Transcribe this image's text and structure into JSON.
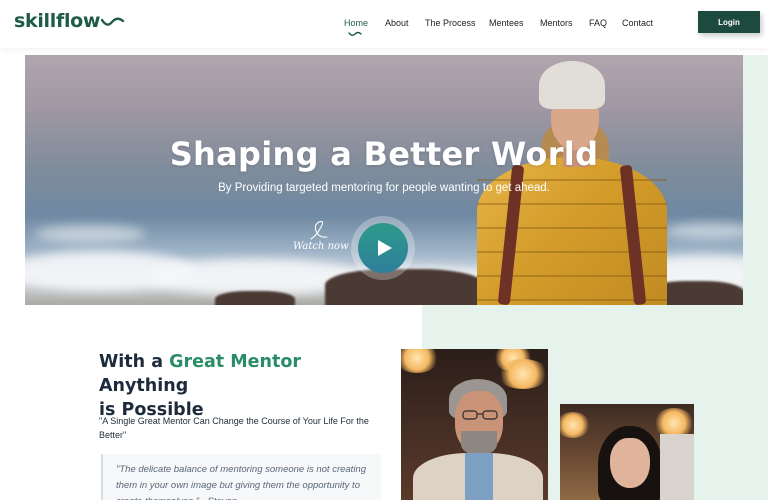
{
  "brand": {
    "logo_text": "skillflow",
    "accent_color": "#1f5c45",
    "button_color": "#1d4a3f",
    "mint_color": "#e5f3ec"
  },
  "nav": {
    "items": [
      {
        "label": "Home",
        "active": true
      },
      {
        "label": "About",
        "active": false
      },
      {
        "label": "The Process",
        "active": false
      },
      {
        "label": "Mentees",
        "active": false
      },
      {
        "label": "Mentors",
        "active": false
      },
      {
        "label": "FAQ",
        "active": false
      },
      {
        "label": "Contact",
        "active": false
      }
    ],
    "login_label": "Login"
  },
  "hero": {
    "title": "Shaping a Better World",
    "subtitle": "By Providing targeted mentoring for people wanting to get ahead.",
    "watch_label": "Watch now",
    "play_icon": "play-icon"
  },
  "intro": {
    "heading_prefix": "With a",
    "heading_accent": "Great Mentor",
    "heading_mid": "Anything",
    "heading_suffix": "is Possible",
    "quote_line": "\"A Single Great Mentor Can Change the Course of Your Life For the Better\"",
    "blockquote": "\"The delicate balance of mentoring someone is not creating them in your own image but giving them the opportunity to create themselves.\" - Steven"
  }
}
